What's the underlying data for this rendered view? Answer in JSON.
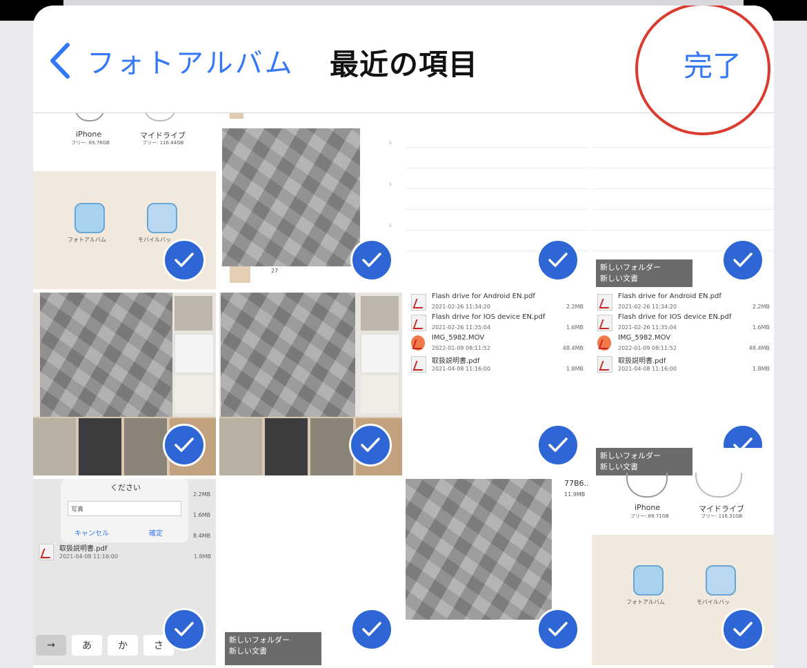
{
  "nav": {
    "back_label": "フォトアルバム",
    "title": "最近の項目",
    "done_label": "完了"
  },
  "thumbs": {
    "a": {
      "iphone_label": "iPhone",
      "iphone_free": "フリー: 69.76GB",
      "drive_label": "マイドライブ",
      "drive_free": "フリー: 116.44GB",
      "album_label": "フォトアルバム",
      "mobile_label": "モバイルバッ"
    },
    "b": {
      "count_label": "27"
    },
    "c": {
      "files": [
        {
          "name": "Flash drive for Android EN.pdf",
          "date": "2021-02-26 11:34:20",
          "size": "2.2MB"
        },
        {
          "name": "Flash drive for IOS device  EN.pdf",
          "date": "2021-02-26 11:35:04",
          "size": "1.6MB"
        },
        {
          "name": "IMG_5982.MOV",
          "date": "2022-01-09 08:11:52",
          "size": "48.4MB"
        },
        {
          "name": "取扱説明書.pdf",
          "date": "2021-04-08 11:16:00",
          "size": "1.8MB"
        }
      ]
    },
    "d": {
      "menu_new_folder": "新しいフォルダー",
      "menu_new_doc": "新しい文書"
    },
    "g": {
      "dialog_title": "ください",
      "input_value": "写真",
      "cancel": "キャンセル",
      "confirm": "確定",
      "sizes": [
        "2.2MB",
        "1.6MB",
        "8.4MB"
      ],
      "file_name": "取扱説明書.pdf",
      "file_date": "2021-04-08 11:16:00",
      "file_size": "1.8MB",
      "keys": [
        "→",
        "あ",
        "か",
        "さ"
      ]
    },
    "h": {
      "menu_new_folder": "新しいフォルダー",
      "menu_new_doc": "新しい文書"
    },
    "i": {
      "partial_name": "77B6...",
      "partial_size": "11.9MB"
    },
    "j": {
      "menu_new_folder": "新しいフォルダー",
      "menu_new_doc": "新しい文書",
      "iphone_label": "iPhone",
      "iphone_free": "フリー: 69.71GB",
      "drive_label": "マイドライブ",
      "drive_free": "フリー: 116.31GB",
      "album_label": "フォトアルバム",
      "mobile_label": "モバイルバッ"
    }
  },
  "colors": {
    "accent": "#3478f6",
    "check": "#2f66d6",
    "annotation": "#dc3a2f"
  }
}
